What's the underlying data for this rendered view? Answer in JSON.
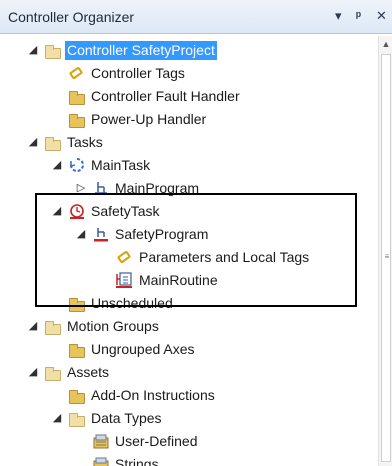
{
  "header": {
    "title": "Controller Organizer",
    "pin_glyph": "▾",
    "autohide_glyph": "ᛜ",
    "close_glyph": "✕"
  },
  "tree": {
    "items": [
      {
        "label": "Controller SafetyProject",
        "icon": "controller-folder-icon",
        "expander": "◢",
        "selected": true
      },
      {
        "label": "Controller Tags",
        "icon": "tag-icon",
        "expander": ""
      },
      {
        "label": "Controller Fault Handler",
        "icon": "folder-icon",
        "expander": ""
      },
      {
        "label": "Power-Up Handler",
        "icon": "folder-icon",
        "expander": ""
      },
      {
        "label": "Tasks",
        "icon": "open-folder-icon",
        "expander": "◢"
      },
      {
        "label": "MainTask",
        "icon": "continuous-task-icon",
        "expander": "◢"
      },
      {
        "label": "MainProgram",
        "icon": "program-icon",
        "expander": "▷"
      },
      {
        "label": "SafetyTask",
        "icon": "safety-task-icon",
        "expander": "◢"
      },
      {
        "label": "SafetyProgram",
        "icon": "safety-program-icon",
        "expander": "◢"
      },
      {
        "label": "Parameters and Local Tags",
        "icon": "tag-icon",
        "expander": ""
      },
      {
        "label": "MainRoutine",
        "icon": "routine-icon",
        "expander": ""
      },
      {
        "label": "Unscheduled",
        "icon": "folder-icon",
        "expander": ""
      },
      {
        "label": "Motion Groups",
        "icon": "open-folder-icon",
        "expander": "◢"
      },
      {
        "label": "Ungrouped Axes",
        "icon": "folder-icon",
        "expander": ""
      },
      {
        "label": "Assets",
        "icon": "open-folder-icon",
        "expander": "◢"
      },
      {
        "label": "Add-On Instructions",
        "icon": "folder-icon",
        "expander": ""
      },
      {
        "label": "Data Types",
        "icon": "open-folder-icon",
        "expander": "◢"
      },
      {
        "label": "User-Defined",
        "icon": "datatype-icon",
        "expander": ""
      },
      {
        "label": "Strings",
        "icon": "datatype-icon",
        "expander": ""
      }
    ]
  },
  "scrollbar": {
    "up_glyph": "▲",
    "grip": "≡"
  }
}
